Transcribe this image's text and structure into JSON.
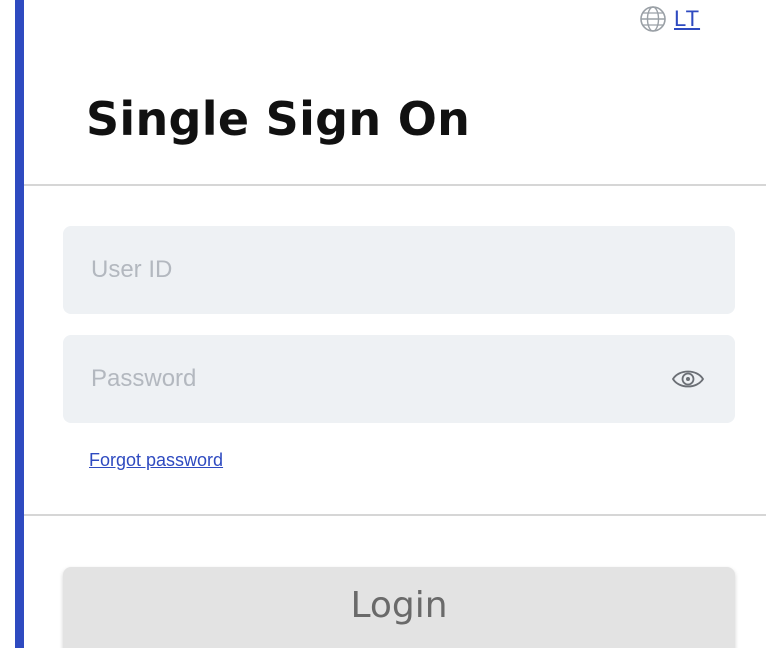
{
  "header": {
    "language_code": "LT",
    "language_icon": "globe-icon",
    "title": "Single Sign On"
  },
  "form": {
    "user_id_placeholder": "User ID",
    "password_placeholder": "Password",
    "toggle_visibility_icon": "eye-icon",
    "forgot_password_label": "Forgot password"
  },
  "actions": {
    "login_label": "Login"
  },
  "colors": {
    "accent": "#2e4ac0",
    "field_background": "#eef1f4",
    "login_button_background": "#e3e3e3"
  }
}
